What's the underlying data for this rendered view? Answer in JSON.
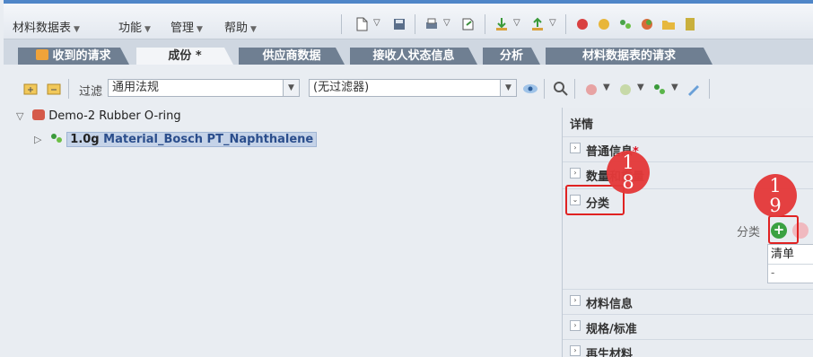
{
  "menu": {
    "items": [
      {
        "label": "材料数据表"
      },
      {
        "label": "功能"
      },
      {
        "label": "管理"
      },
      {
        "label": "帮助"
      }
    ]
  },
  "tabs": [
    {
      "label": "收到的请求"
    },
    {
      "label": "成份 *"
    },
    {
      "label": "供应商数据"
    },
    {
      "label": "接收人状态信息"
    },
    {
      "label": "分析"
    },
    {
      "label": "材料数据表的请求"
    }
  ],
  "filterbar": {
    "filter_label": "过滤",
    "regulation_value": "通用法规",
    "filter_value": "(无过滤器)"
  },
  "tree": {
    "root_label": "Demo-2 Rubber O-ring",
    "child_qty": "1.0g",
    "child_label": "Material_Bosch PT_Naphthalene"
  },
  "panel": {
    "title": "详情",
    "sections": {
      "general": "普通信息",
      "general_required": "*",
      "quantity": "数量和重量",
      "classification": "分类",
      "material_info": "材料信息",
      "spec": "规格/标准",
      "recycled": "再生材料"
    },
    "classification_label": "分类",
    "add_symbol": "+",
    "list_header": "清单",
    "list_value": "-"
  },
  "annotations": {
    "badge_18": "1\n8",
    "badge_19": "1\n9",
    "badge_18_top": "1",
    "badge_18_bottom": "8",
    "badge_19_top": "1",
    "badge_19_bottom": "9"
  }
}
